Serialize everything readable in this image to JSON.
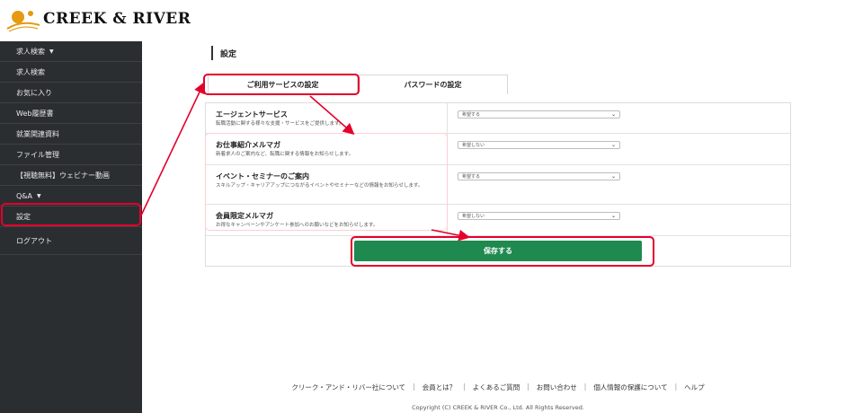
{
  "header": {
    "logo_text": "CREEK & RIVER"
  },
  "sidebar": {
    "items": [
      {
        "label": "求人検索",
        "caret": "▼"
      },
      {
        "label": "求人検索"
      },
      {
        "label": "お気に入り"
      },
      {
        "label": "Web履歴書"
      },
      {
        "label": "就業関連資料"
      },
      {
        "label": "ファイル管理"
      },
      {
        "label": "【視聴無料】ウェビナー動画"
      },
      {
        "label": "Q&A",
        "caret": "▼"
      },
      {
        "label": "設定"
      },
      {
        "label": "ログアウト"
      }
    ]
  },
  "main": {
    "title": "設定",
    "tabs": [
      {
        "label": "ご利用サービスの設定"
      },
      {
        "label": "パスワードの設定"
      }
    ],
    "rows": [
      {
        "title": "エージェントサービス",
        "desc": "転職活動に関する様々な支援・サービスをご提供します。",
        "value": "希望する"
      },
      {
        "title": "お仕事紹介メルマガ",
        "desc": "新着求人のご案内など、転職に関する情報をお知らせします。",
        "value": "希望しない"
      },
      {
        "title": "イベント・セミナーのご案内",
        "desc": "スキルアップ・キャリアアップにつながるイベントやセミナーなどの情報をお知らせします。",
        "value": "希望する"
      },
      {
        "title": "会員限定メルマガ",
        "desc": "お得なキャンペーンやアンケート参加へのお願いなどをお知らせします。",
        "value": "希望しない"
      }
    ],
    "save_label": "保存する"
  },
  "footer": {
    "links": [
      "クリーク・アンド・リバー社について",
      "会員とは？",
      "よくあるご質問",
      "お問い合わせ",
      "個人情報の保護について",
      "ヘルプ"
    ],
    "copyright": "Copyright (C) CREEK & RIVER Co., Ltd. All Rights Reserved."
  },
  "colors": {
    "sidebar_bg": "#2b2e31",
    "accent_green": "#1e8a4f",
    "annotation_red": "#e4002b"
  },
  "icons": {
    "logo": "creek-river-logo-icon",
    "caret": "caret-down-icon",
    "select_chevron": "chevron-down-icon"
  }
}
